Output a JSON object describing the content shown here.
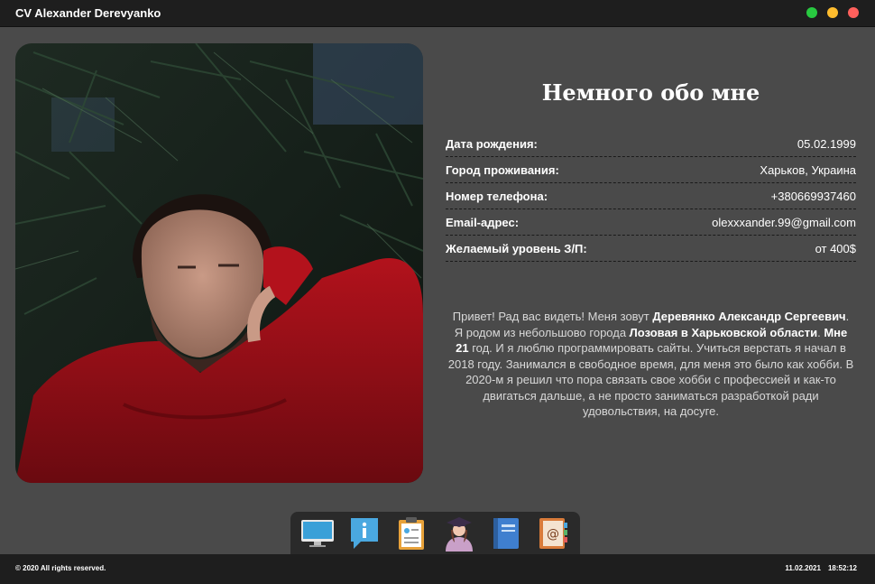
{
  "window": {
    "title": "CV Alexander Derevyanko",
    "controls": [
      {
        "name": "green",
        "color": "#28c940"
      },
      {
        "name": "yellow",
        "color": "#ffbd2e"
      },
      {
        "name": "red",
        "color": "#ff605c"
      }
    ]
  },
  "about": {
    "heading": "Немного обо мне",
    "rows": [
      {
        "label": "Дата рождения:",
        "value": "05.02.1999"
      },
      {
        "label": "Город проживания:",
        "value": "Харьков, Украина"
      },
      {
        "label": "Номер телефона:",
        "value": "+380669937460"
      },
      {
        "label": "Email-адрес:",
        "value": "olexxxander.99@gmail.com"
      },
      {
        "label": "Желаемый уровень З/П:",
        "value": "от 400$"
      }
    ],
    "bio": {
      "p1": "Привет! Рад вас видеть! Меня зовут ",
      "name": "Деревянко Александр Сергеевич",
      "p2": ". Я родом из небольшово города ",
      "city": "Лозовая в Харьковской области",
      "p3": ". ",
      "age": "Мне 21",
      "p4": " год. И я люблю программировать сайты. Учиться верстать я начал в 2018 году. Занимался в свободное время, для меня это было как хобби. В 2020-м я решил что пора связать свое хобби с профессией и как-то двигаться дальше, а не просто заниматься разработкой ради удовольствия, на досуге."
    }
  },
  "dock": {
    "items": [
      {
        "icon": "monitor-icon"
      },
      {
        "icon": "info-chat-icon"
      },
      {
        "icon": "clipboard-resume-icon"
      },
      {
        "icon": "graduate-icon"
      },
      {
        "icon": "notebook-icon"
      },
      {
        "icon": "address-book-icon"
      }
    ]
  },
  "footer": {
    "copyright": "© 2020 All rights reserved.",
    "date": "11.02.2021",
    "time": "18:52:12"
  }
}
